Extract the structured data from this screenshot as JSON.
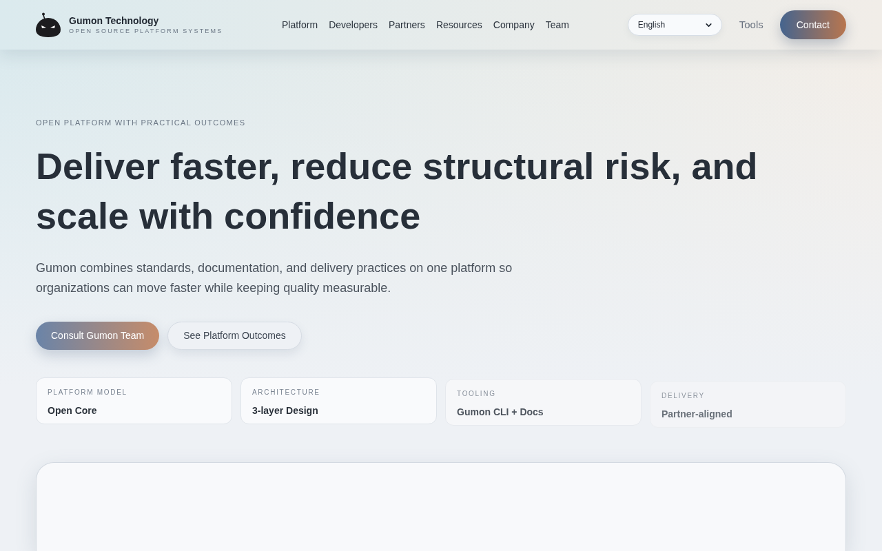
{
  "header": {
    "brand": {
      "name": "Gumon Technology",
      "tagline": "OPEN SOURCE PLATFORM SYSTEMS"
    },
    "nav": [
      "Platform",
      "Developers",
      "Partners",
      "Resources",
      "Company",
      "Team"
    ],
    "language_select": {
      "value": "English"
    },
    "tools_link": "Tools",
    "contact_button": "Contact"
  },
  "hero": {
    "eyebrow": "OPEN PLATFORM WITH PRACTICAL OUTCOMES",
    "title": "Deliver faster, reduce structural risk, and scale with confidence",
    "description": "Gumon combines standards, documentation, and delivery practices on one platform so organizations can move faster while keeping quality measurable.",
    "buttons": [
      {
        "label": "Consult Gumon Team",
        "kind": "primary"
      },
      {
        "label": "See Platform Outcomes",
        "kind": "secondary"
      }
    ],
    "highlights": [
      {
        "label": "PLATFORM MODEL",
        "value": "Open Core",
        "kind": "shown"
      },
      {
        "label": "ARCHITECTURE",
        "value": "3-layer Design",
        "kind": "shown"
      },
      {
        "label": "TOOLING",
        "value": "Gumon CLI + Docs",
        "kind": "fading"
      },
      {
        "label": "DELIVERY",
        "value": "Partner-aligned",
        "kind": "faint"
      }
    ]
  }
}
